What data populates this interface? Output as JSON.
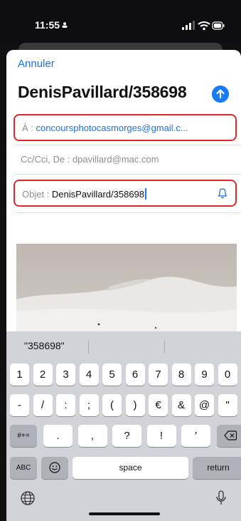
{
  "status_bar": {
    "time": "11:55"
  },
  "compose": {
    "cancel_label": "Annuler",
    "title": "DenisPavillard/358698",
    "to_label": "À : ",
    "to_value": "concoursphotocasmorges@gmail.c...",
    "cc_text": "Cc/Cci, De : dpavillard@mac.com",
    "subject_label": "Objet : ",
    "subject_value": "DenisPavillard/358698"
  },
  "keyboard": {
    "suggestion": "\"358698\"",
    "row1": [
      "1",
      "2",
      "3",
      "4",
      "5",
      "6",
      "7",
      "8",
      "9",
      "0"
    ],
    "row2": [
      "-",
      "/",
      ":",
      ";",
      "(",
      ")",
      "€",
      "&",
      "@",
      "\""
    ],
    "row3_left": "#+=",
    "row3": [
      ".",
      ",",
      "?",
      "!",
      "'"
    ],
    "abc": "ABC",
    "space": "space",
    "return": "return"
  },
  "colors": {
    "accent": "#1a73e8",
    "highlight_outline": "#e22525",
    "keyboard_bg": "#d1d3d9"
  },
  "icons": [
    "person-icon",
    "signal-icon",
    "wifi-icon",
    "battery-icon",
    "send-arrow-icon",
    "bell-icon",
    "delete-icon",
    "emoji-icon",
    "globe-icon",
    "microphone-icon"
  ]
}
